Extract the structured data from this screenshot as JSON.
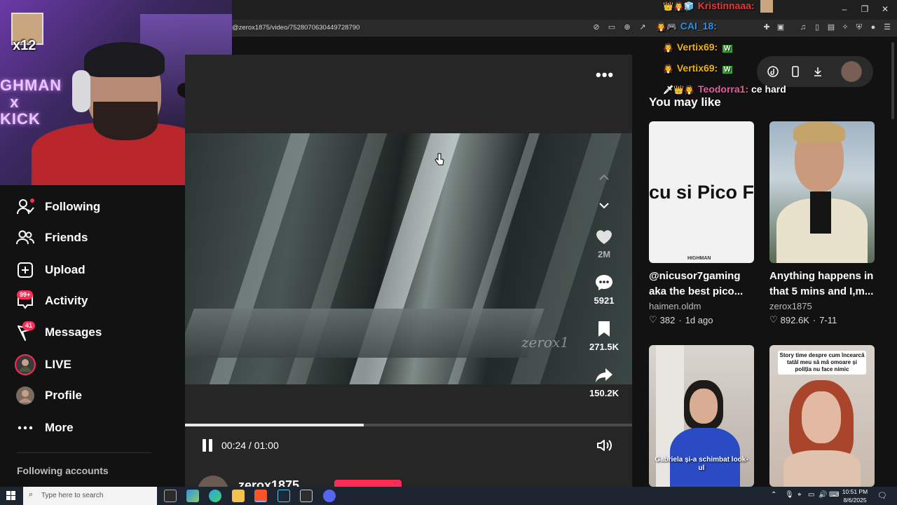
{
  "browser": {
    "url": "@zerox1875/video/7528070630449728790"
  },
  "sidebar": {
    "items": [
      {
        "label": "Following",
        "icon": "following-icon"
      },
      {
        "label": "Friends",
        "icon": "friends-icon"
      },
      {
        "label": "Upload",
        "icon": "upload-icon"
      },
      {
        "label": "Activity",
        "icon": "activity-icon",
        "badge": "99+"
      },
      {
        "label": "Messages",
        "icon": "messages-icon",
        "badge": "41"
      },
      {
        "label": "LIVE",
        "icon": "live-icon"
      },
      {
        "label": "Profile",
        "icon": "profile-icon"
      },
      {
        "label": "More",
        "icon": "more-icon"
      }
    ],
    "following_accounts": "Following accounts"
  },
  "webcam": {
    "multiplier": "x12",
    "neon_text": "GHMAN\n x\nKICK"
  },
  "video": {
    "watermark": "zerox1",
    "time": "00:24 / 01:00",
    "progress": 0.4,
    "author": "zerox1875",
    "actions": {
      "likes": "2M",
      "comments": "5921",
      "saves": "271.5K",
      "shares": "150.2K"
    }
  },
  "right_panel": {
    "title": "You may like",
    "cards": [
      {
        "thumb_text": "cu si Pico F",
        "thumb_logo": "HIGHMAN",
        "title": "@nicusor7gaming aka the best pico...",
        "author": "haimen.oldm",
        "likes": "382",
        "date": "1d ago"
      },
      {
        "thumb_text": "",
        "thumb_logo": "",
        "title": "Anything happens in that 5 mins and I,m...",
        "author": "zerox1875",
        "likes": "892.6K",
        "date": "7-11"
      },
      {
        "thumb_text": "Gabriela și-a schimbat look-ul",
        "thumb_logo": "",
        "title": "",
        "author": "",
        "likes": "",
        "date": ""
      },
      {
        "thumb_text": "Story time despre cum încearcă tatăl meu să mă omoare și poliția nu face nimic",
        "thumb_logo": "",
        "title": "",
        "author": "",
        "likes": "",
        "date": ""
      }
    ]
  },
  "chat": [
    {
      "user": "Kristinnaaa:",
      "message": "",
      "color": "#e33a3a",
      "icons": "👑🧛🧊"
    },
    {
      "user": "CAI_18:",
      "message": "",
      "color": "#2f8fe8",
      "icons": "🧛🎮"
    },
    {
      "user": "Vertix69:",
      "message": "W",
      "color": "#f5b400",
      "icons": "🧛"
    },
    {
      "user": "Vertix69:",
      "message": "W",
      "color": "#f5b400",
      "icons": "🧛"
    },
    {
      "user": "Teodorra1:",
      "message": "ce hard",
      "color": "#e85fa0",
      "icons": "🗡👑🧛"
    }
  ],
  "taskbar": {
    "search_placeholder": "Type here to search",
    "time": "10:51 PM",
    "date": "8/6/2025"
  },
  "colors": {
    "accent": "#fe2c55",
    "background": "#121212",
    "panel": "#262626"
  }
}
